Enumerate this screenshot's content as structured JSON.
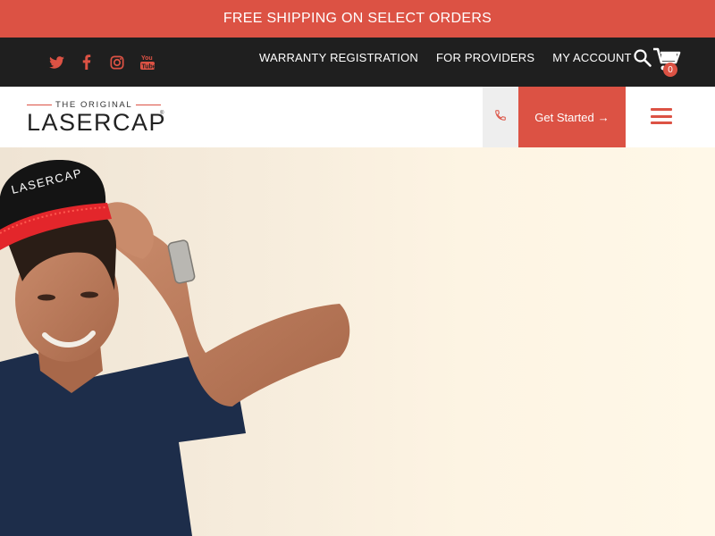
{
  "promo": {
    "text": "FREE SHIPPING ON SELECT ORDERS"
  },
  "social": {
    "icons": [
      "twitter-icon",
      "facebook-icon",
      "instagram-icon",
      "youtube-icon"
    ]
  },
  "utility_nav": {
    "items": [
      {
        "label": "WARRANTY REGISTRATION"
      },
      {
        "label": "FOR PROVIDERS"
      },
      {
        "label": "MY ACCOUNT"
      }
    ]
  },
  "cart": {
    "count": "0"
  },
  "logo": {
    "tagline": "THE ORIGINAL",
    "wordmark": "LASERCAP",
    "registered": "®"
  },
  "header": {
    "cta_label": "Get Started",
    "cta_arrow": "→"
  },
  "hero": {
    "cap_text": "LASERCAP"
  },
  "colors": {
    "accent": "#dc5244",
    "dark_bar": "#1f1f1f",
    "hero_bg": "#fdf4e3"
  }
}
